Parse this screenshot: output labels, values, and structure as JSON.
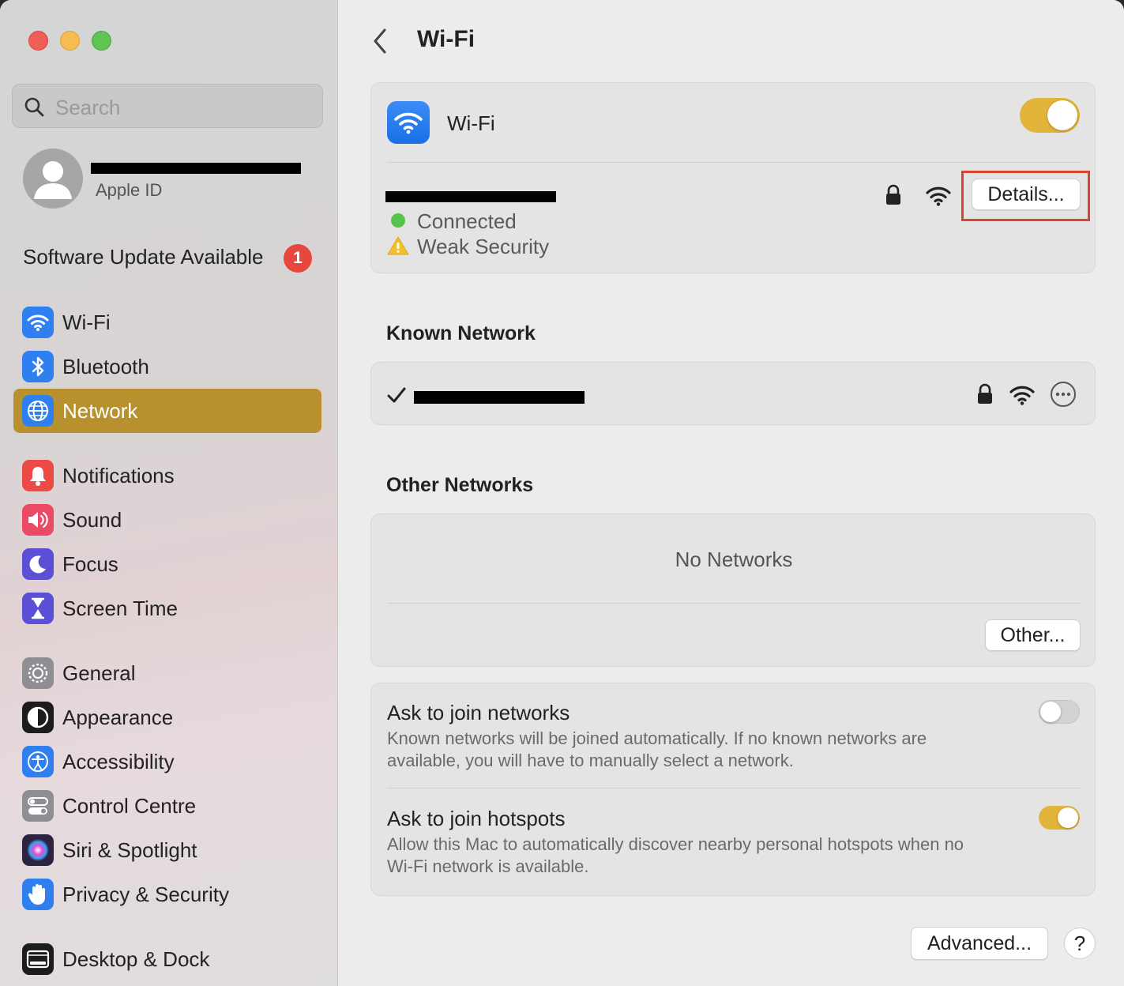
{
  "sidebar": {
    "search_placeholder": "Search",
    "account_sub": "Apple ID",
    "software_update": "Software Update Available",
    "update_badge": "1",
    "items": [
      {
        "label": "Wi-Fi",
        "icon": "wifi-icon",
        "color": "#2f7ff1"
      },
      {
        "label": "Bluetooth",
        "icon": "bluetooth-icon",
        "color": "#2f7ff1"
      },
      {
        "label": "Network",
        "icon": "globe-icon",
        "color": "#2f7ff1"
      },
      {
        "label": "Notifications",
        "icon": "bell-icon",
        "color": "#ec4b45"
      },
      {
        "label": "Sound",
        "icon": "speaker-icon",
        "color": "#ec4966"
      },
      {
        "label": "Focus",
        "icon": "moon-icon",
        "color": "#5b4fd6"
      },
      {
        "label": "Screen Time",
        "icon": "hourglass-icon",
        "color": "#5b4fd6"
      },
      {
        "label": "General",
        "icon": "gear-icon",
        "color": "#8e8e93"
      },
      {
        "label": "Appearance",
        "icon": "appearance-icon",
        "color": "#1c1c1e"
      },
      {
        "label": "Accessibility",
        "icon": "accessibility-icon",
        "color": "#2f7ff1"
      },
      {
        "label": "Control Centre",
        "icon": "control-centre-icon",
        "color": "#8e8e93"
      },
      {
        "label": "Siri & Spotlight",
        "icon": "siri-icon",
        "color": "#3a2d5a"
      },
      {
        "label": "Privacy & Security",
        "icon": "hand-icon",
        "color": "#2f7ff1"
      },
      {
        "label": "Desktop & Dock",
        "icon": "dock-icon",
        "color": "#1c1c1e"
      }
    ],
    "active_item": "Network"
  },
  "main": {
    "title": "Wi-Fi",
    "wifi_label": "Wi-Fi",
    "wifi_enabled": true,
    "current_network": {
      "status_connected": "Connected",
      "status_security": "Weak Security",
      "details_button": "Details..."
    },
    "known_title": "Known Network",
    "other_title": "Other Networks",
    "no_networks": "No Networks",
    "other_button": "Other...",
    "ask_join_networks": {
      "label": "Ask to join networks",
      "description_line1": "Known networks will be joined automatically. If no known networks are",
      "description_line2": "available, you will have to manually select a network.",
      "enabled": false
    },
    "ask_join_hotspots": {
      "label": "Ask to join hotspots",
      "description_line1": "Allow this Mac to automatically discover nearby personal hotspots when no",
      "description_line2": "Wi-Fi network is available.",
      "enabled": true
    },
    "advanced_button": "Advanced...",
    "help_button": "?"
  },
  "colors": {
    "accent": "#e3b43a",
    "sidebar_selected": "#b8912e",
    "highlight_box": "#d9452f"
  }
}
